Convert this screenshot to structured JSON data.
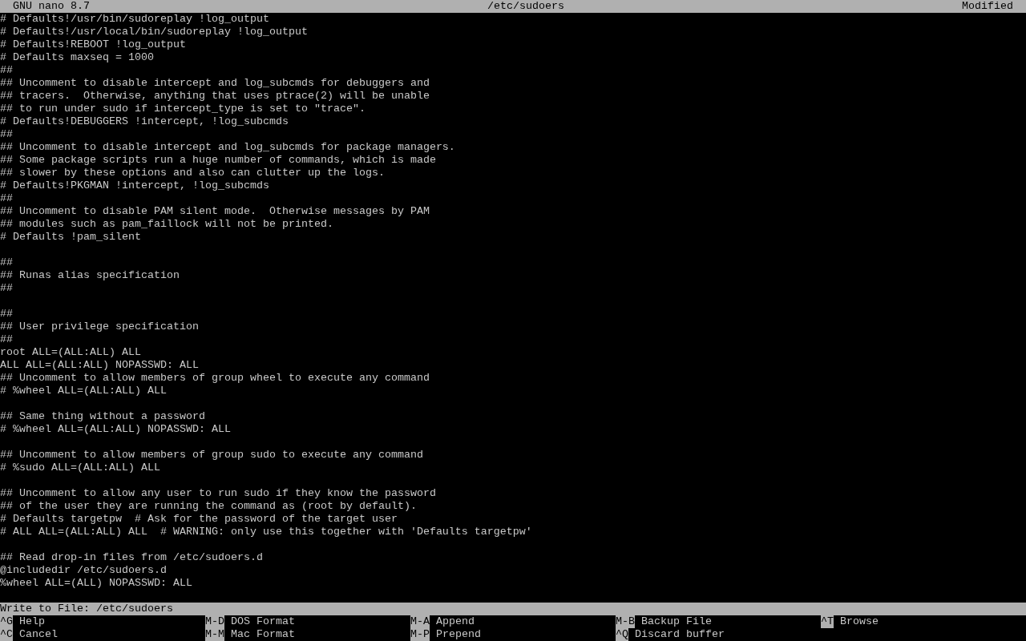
{
  "title_bar": {
    "app": "GNU nano 8.7",
    "file": "/etc/sudoers",
    "status": "Modified"
  },
  "lines": [
    {
      "kind": "text",
      "text": "# Defaults!/usr/bin/sudoreplay !log_output"
    },
    {
      "kind": "text",
      "text": "# Defaults!/usr/local/bin/sudoreplay !log_output"
    },
    {
      "kind": "text",
      "text": "# Defaults!REBOOT !log_output"
    },
    {
      "kind": "text",
      "text": "# Defaults maxseq = 1000"
    },
    {
      "kind": "text",
      "text": "##"
    },
    {
      "kind": "text",
      "text": "## Uncomment to disable intercept and log_subcmds for debuggers and"
    },
    {
      "kind": "text",
      "text": "## tracers.  Otherwise, anything that uses ptrace(2) will be unable"
    },
    {
      "kind": "text",
      "text": "## to run under sudo if intercept_type is set to \"trace\"."
    },
    {
      "kind": "text",
      "text": "# Defaults!DEBUGGERS !intercept, !log_subcmds"
    },
    {
      "kind": "text",
      "text": "##"
    },
    {
      "kind": "text",
      "text": "## Uncomment to disable intercept and log_subcmds for package managers."
    },
    {
      "kind": "text",
      "text": "## Some package scripts run a huge number of commands, which is made"
    },
    {
      "kind": "text",
      "text": "## slower by these options and also can clutter up the logs."
    },
    {
      "kind": "text",
      "text": "# Defaults!PKGMAN !intercept, !log_subcmds"
    },
    {
      "kind": "text",
      "text": "##"
    },
    {
      "kind": "text",
      "text": "## Uncomment to disable PAM silent mode.  Otherwise messages by PAM"
    },
    {
      "kind": "text",
      "text": "## modules such as pam_faillock will not be printed."
    },
    {
      "kind": "text",
      "text": "# Defaults !pam_silent"
    },
    {
      "kind": "blank"
    },
    {
      "kind": "text",
      "text": "##"
    },
    {
      "kind": "text",
      "text": "## Runas alias specification"
    },
    {
      "kind": "text",
      "text": "##"
    },
    {
      "kind": "blank"
    },
    {
      "kind": "text",
      "text": "##"
    },
    {
      "kind": "text",
      "text": "## User privilege specification"
    },
    {
      "kind": "text",
      "text": "##"
    },
    {
      "kind": "text",
      "text": "root ALL=(ALL:ALL) ALL"
    },
    {
      "kind": "text",
      "text": "ALL ALL=(ALL:ALL) NOPASSWD: ALL"
    },
    {
      "kind": "text",
      "text": "## Uncomment to allow members of group wheel to execute any command"
    },
    {
      "kind": "text",
      "text": "# %wheel ALL=(ALL:ALL) ALL"
    },
    {
      "kind": "blank"
    },
    {
      "kind": "text",
      "text": "## Same thing without a password"
    },
    {
      "kind": "text",
      "text": "# %wheel ALL=(ALL:ALL) NOPASSWD: ALL"
    },
    {
      "kind": "blank"
    },
    {
      "kind": "text",
      "text": "## Uncomment to allow members of group sudo to execute any command"
    },
    {
      "kind": "text",
      "text": "# %sudo ALL=(ALL:ALL) ALL"
    },
    {
      "kind": "blank"
    },
    {
      "kind": "text",
      "text": "## Uncomment to allow any user to run sudo if they know the password"
    },
    {
      "kind": "text",
      "text": "## of the user they are running the command as (root by default)."
    },
    {
      "kind": "text",
      "text": "# Defaults targetpw  # Ask for the password of the target user"
    },
    {
      "kind": "text",
      "text": "# ALL ALL=(ALL:ALL) ALL  # WARNING: only use this together with 'Defaults targetpw'"
    },
    {
      "kind": "blank"
    },
    {
      "kind": "text",
      "text": "## Read drop-in files from /etc/sudoers.d"
    },
    {
      "kind": "text",
      "text": "@includedir /etc/sudoers.d"
    },
    {
      "kind": "text",
      "text": "%wheel ALL=(ALL) NOPASSWD: ALL"
    }
  ],
  "prompt": {
    "label": "Write to File:",
    "value": "/etc/sudoers"
  },
  "shortcuts": [
    [
      {
        "key": "^G",
        "label": "Help"
      },
      {
        "key": "M-D",
        "label": "DOS Format"
      },
      {
        "key": "M-A",
        "label": "Append"
      },
      {
        "key": "M-B",
        "label": "Backup File"
      },
      {
        "key": "^T",
        "label": "Browse"
      }
    ],
    [
      {
        "key": "^C",
        "label": "Cancel"
      },
      {
        "key": "M-M",
        "label": "Mac Format"
      },
      {
        "key": "M-P",
        "label": "Prepend"
      },
      {
        "key": "^Q",
        "label": "Discard buffer"
      }
    ]
  ]
}
